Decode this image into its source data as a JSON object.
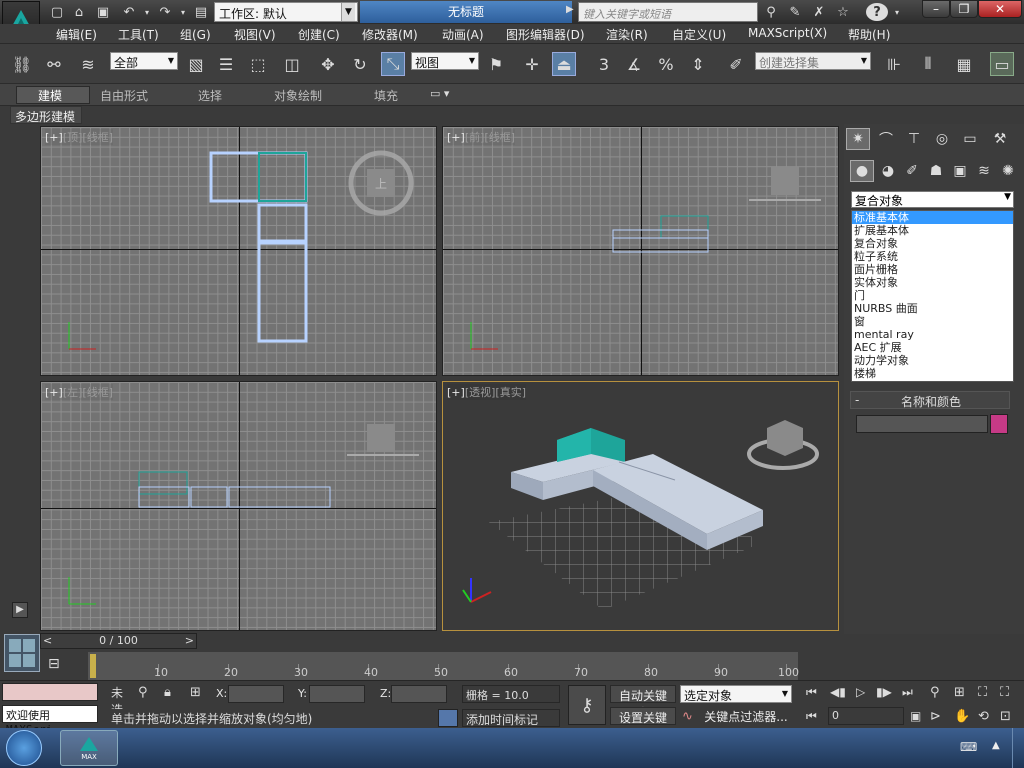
{
  "title_bar": {
    "workspace_label": "工作区: 默认",
    "document_title": "无标题",
    "search_placeholder": "键入关键字或短语"
  },
  "menu": [
    "编辑(E)",
    "工具(T)",
    "组(G)",
    "视图(V)",
    "创建(C)",
    "修改器(M)",
    "动画(A)",
    "图形编辑器(D)",
    "渲染(R)",
    "自定义(U)",
    "MAXScript(X)",
    "帮助(H)"
  ],
  "toolbar": {
    "filter_select": "全部",
    "ref_coord_select": "视图",
    "angle_snap_label": "3",
    "percent_snap_label": "%",
    "selection_set_placeholder": "创建选择集"
  },
  "ribbon": {
    "tabs": [
      "建模",
      "自由形式",
      "选择",
      "对象绘制",
      "填充"
    ],
    "subpanel": "多边形建模"
  },
  "viewports": {
    "top": {
      "plus": "[+]",
      "view": "[顶]",
      "shade": "[线框]"
    },
    "front": {
      "plus": "[+]",
      "view": "[前]",
      "shade": "[线框]"
    },
    "left": {
      "plus": "[+]",
      "view": "[左]",
      "shade": "[线框]"
    },
    "perspective": {
      "plus": "[+]",
      "view": "[透视]",
      "shade": "[真实]"
    }
  },
  "command_panel": {
    "type_dropdown_value": "复合对象",
    "type_options": [
      "标准基本体",
      "扩展基本体",
      "复合对象",
      "粒子系统",
      "面片栅格",
      "实体对象",
      "门",
      "NURBS 曲面",
      "窗",
      "mental ray",
      "AEC 扩展",
      "动力学对象",
      "楼梯"
    ],
    "selected_option": "标准基本体",
    "rollout_name_color": "名称和颜色",
    "rollout_collapse": "-",
    "object_color": "#c63a86"
  },
  "timeline": {
    "frame_display": "0 / 100",
    "ticks": [
      "10",
      "20",
      "30",
      "40",
      "50",
      "60",
      "70",
      "80",
      "90",
      "100"
    ]
  },
  "status": {
    "maxscript_prompt": "欢迎使用 MAXScri",
    "selection_status": "未选",
    "x_label": "X:",
    "y_label": "Y:",
    "z_label": "Z:",
    "grid": "栅格 = 10.0",
    "auto_key": "自动关键点",
    "selected_object": "选定对象",
    "set_key": "设置关键点",
    "key_filter": "关键点过滤器...",
    "prompt": "单击并拖动以选择并缩放对象(均匀地)",
    "add_time_tag": "添加时间标记",
    "frame_value": "0"
  },
  "taskbar": {
    "app_label": "MAX"
  },
  "colors": {
    "accent_blue": "#3399ff",
    "active_viewport_border": "#b7913e",
    "sofa_teal": "#1ea59a",
    "sofa_body": "#bcc6d6"
  }
}
